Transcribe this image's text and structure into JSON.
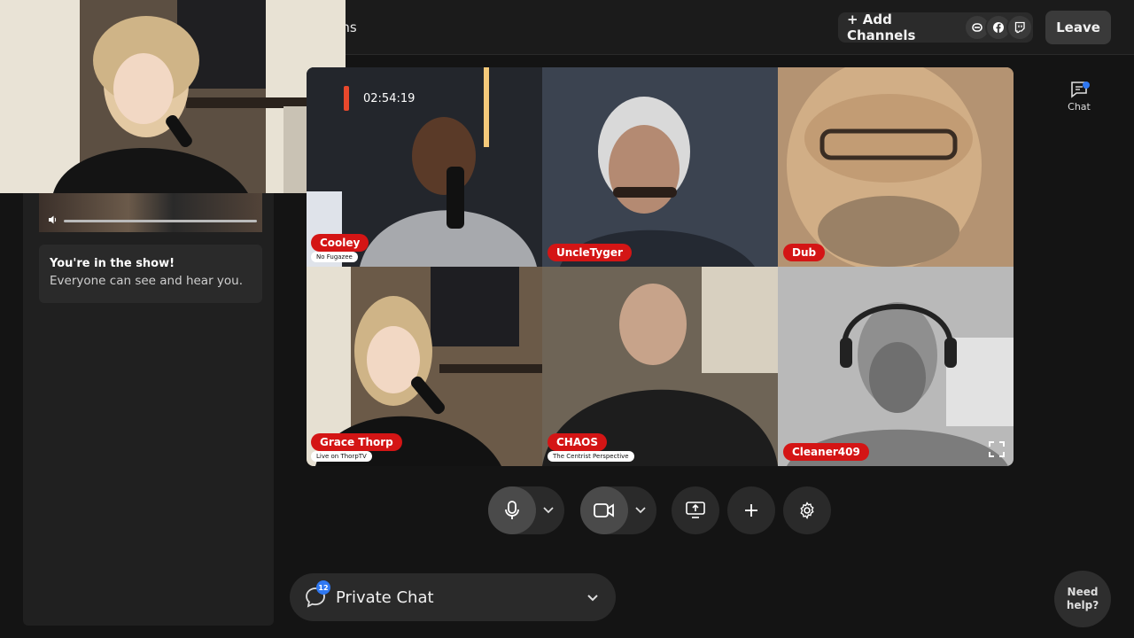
{
  "topbar": {
    "title_fragment": "ions",
    "add_channels_label": "+ Add Channels",
    "channel_icons": [
      "streamyard-icon",
      "facebook-icon",
      "twitch-icon"
    ],
    "leave_label": "Leave"
  },
  "stream": {
    "elapsed": "02:54:19"
  },
  "left_panel": {
    "status_title": "You're in the show!",
    "status_subtitle": "Everyone can see and hear you."
  },
  "participants": [
    {
      "name": "Cooley",
      "subtitle": "No Fugazee"
    },
    {
      "name": "UncleTyger",
      "subtitle": ""
    },
    {
      "name": "Dub",
      "subtitle": ""
    },
    {
      "name": "Grace Thorp",
      "subtitle": "Live on ThorpTV"
    },
    {
      "name": "CHAOS",
      "subtitle": "The Centrist Perspective"
    },
    {
      "name": "Cleaner409",
      "subtitle": ""
    }
  ],
  "chat_tab": {
    "label": "Chat"
  },
  "private_chat": {
    "label": "Private Chat",
    "badge_count": "12"
  },
  "help": {
    "line1": "Need",
    "line2": "help?"
  },
  "colors": {
    "name_tag": "#d41515",
    "accent_blue": "#2f78f2",
    "record": "#e8482c"
  }
}
